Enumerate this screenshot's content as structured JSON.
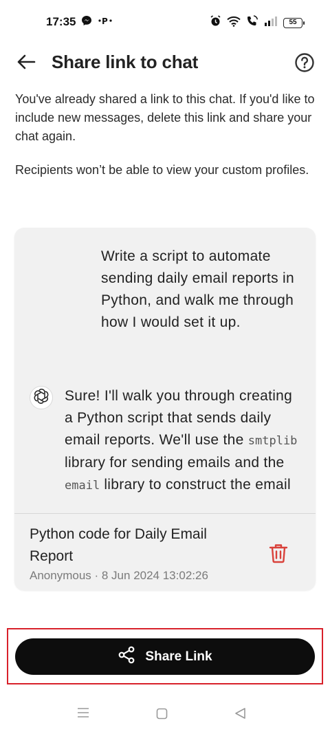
{
  "status_bar": {
    "time": "17:35",
    "battery": "55",
    "icons": [
      "messenger-icon",
      "pinterest-icon",
      "alarm-icon",
      "wifi-icon",
      "call-icon",
      "signal-icon",
      "battery-icon"
    ]
  },
  "header": {
    "title": "Share link to chat",
    "back_icon": "arrow-left-icon",
    "help_icon": "question-circle-icon"
  },
  "description": {
    "paragraph1": "You've already shared a link to this chat. If you'd like to include new messages, delete this link and share your chat again.",
    "paragraph2": "Recipients won’t be able to view your custom profiles."
  },
  "preview": {
    "user_message": "Write a script to automate sending daily email reports in Python, and walk me through how I would set it up.",
    "assistant_message": {
      "part1": "Sure! I'll walk you through creating a Python script that sends daily email reports. We'll use the ",
      "code1": "smtplib",
      "part2": " library for sending emails and the ",
      "code2": "email",
      "part3": " library to construct the email"
    },
    "chat_title": "Python code for Daily Email Report",
    "chat_meta": "Anonymous · 8 Jun 2024 13:02:26"
  },
  "share_button": {
    "label": "Share Link",
    "icon": "share-icon"
  },
  "colors": {
    "accent_delete": "#d9413a",
    "button_bg": "#0d0d0d",
    "card_bg": "#f1f1f1",
    "highlight": "#d8202a"
  }
}
